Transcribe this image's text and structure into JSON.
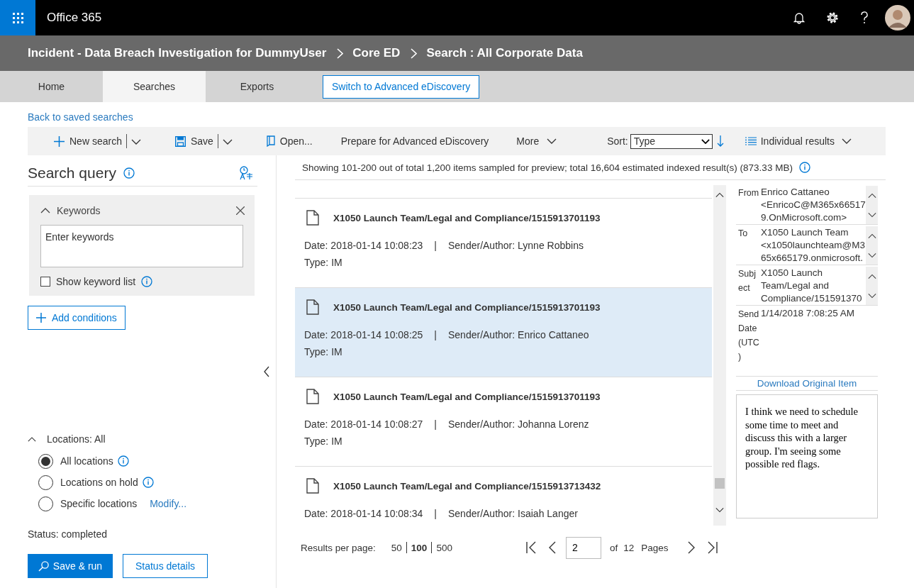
{
  "app_bar": {
    "title": "Office 365"
  },
  "breadcrumb": [
    {
      "label": "Incident - Data Breach Investigation for DummyUser"
    },
    {
      "label": "Core ED"
    },
    {
      "label": "Search : All Corporate Data"
    }
  ],
  "tabs": [
    {
      "label": "Home",
      "selected": false
    },
    {
      "label": "Searches",
      "selected": true
    },
    {
      "label": "Exports",
      "selected": false
    }
  ],
  "tab_button": "Switch to Advanced eDiscovery",
  "back_link": "Back to saved searches",
  "toolbar": {
    "items": [
      {
        "kind": "new",
        "label": "New search"
      },
      {
        "kind": "save",
        "label": "Save"
      },
      {
        "kind": "open",
        "label": "Open..."
      },
      {
        "kind": "plain",
        "label": "Prepare for Advanced eDiscovery"
      },
      {
        "kind": "more",
        "label": "More"
      }
    ],
    "sort_label": "Sort:",
    "sort_value": "Type",
    "view": "Individual results"
  },
  "query": {
    "title": "Search query",
    "keywords": {
      "title": "Keywords",
      "expanded": true,
      "placeholder": "Enter keywords",
      "show_list_label": "Show keyword list",
      "show_list_checked": false
    },
    "add_conditions": "Add conditions",
    "locations": {
      "title": "Locations: All",
      "expanded": true,
      "options": [
        {
          "label": "All locations",
          "selected": true,
          "info": true
        },
        {
          "label": "Locations on hold",
          "selected": false,
          "info": true
        },
        {
          "label": "Specific locations",
          "selected": false,
          "info": false,
          "link": "Modify..."
        }
      ]
    },
    "status": "Status: completed",
    "run_button": "Save & run",
    "details_button": "Status details"
  },
  "results": {
    "summary": "Showing 101-200 out of total 1,200 items sampled for preview; total 16,604 estimated indexed result(s) (873.33 MB)",
    "items": [
      {
        "title": "X1050 Launch Team/Legal and Compliance/1515913701193",
        "date": "Date: 2018-01-14 10:08:23",
        "separator": "|",
        "sender": "Sender/Author: Lynne Robbins",
        "type": "Type: IM",
        "selected": false
      },
      {
        "title": "X1050 Launch Team/Legal and Compliance/1515913701193",
        "date": "Date: 2018-01-14 10:08:25",
        "separator": "|",
        "sender": "Sender/Author: Enrico Cattaneo",
        "type": "Type: IM",
        "selected": true
      },
      {
        "title": "X1050 Launch Team/Legal and Compliance/1515913701193",
        "date": "Date: 2018-01-14 10:08:27",
        "separator": "|",
        "sender": "Sender/Author: Johanna Lorenz",
        "type": "Type: IM",
        "selected": false
      },
      {
        "title": "X1050 Launch Team/Legal and Compliance/1515913713432",
        "date": "Date: 2018-01-14 10:08:34",
        "separator": "|",
        "sender": "Sender/Author: Isaiah Langer",
        "selected": false
      }
    ]
  },
  "detail": {
    "fields": [
      {
        "label": "From",
        "value": "Enrico Cattaneo <EnricoC@M365x665179.OnMicrosoft.com>",
        "scrollable": true
      },
      {
        "label": "To",
        "value": "X1050 Launch Team <x1050launchteam@M365x665179.onmicrosoft.",
        "scrollable": true
      },
      {
        "label": "Subject",
        "value": "X1050 Launch Team/Legal and Compliance/151591370",
        "scrollable": true
      },
      {
        "label": "Send Date (UTC)",
        "value": "1/14/2018 7:08:25 AM",
        "scrollable": false
      }
    ],
    "download": "Download Original Item",
    "body": "I think we need to schedule some time to meet and discuss this with a larger group. I'm seeing some possible red flags."
  },
  "pager": {
    "per_page_label": "Results per page:",
    "sizes": [
      {
        "label": "50",
        "selected": false
      },
      {
        "label": "100",
        "selected": true
      },
      {
        "label": "500",
        "selected": false
      }
    ],
    "page": "2",
    "of": "of",
    "total": "12",
    "pages": "Pages"
  }
}
